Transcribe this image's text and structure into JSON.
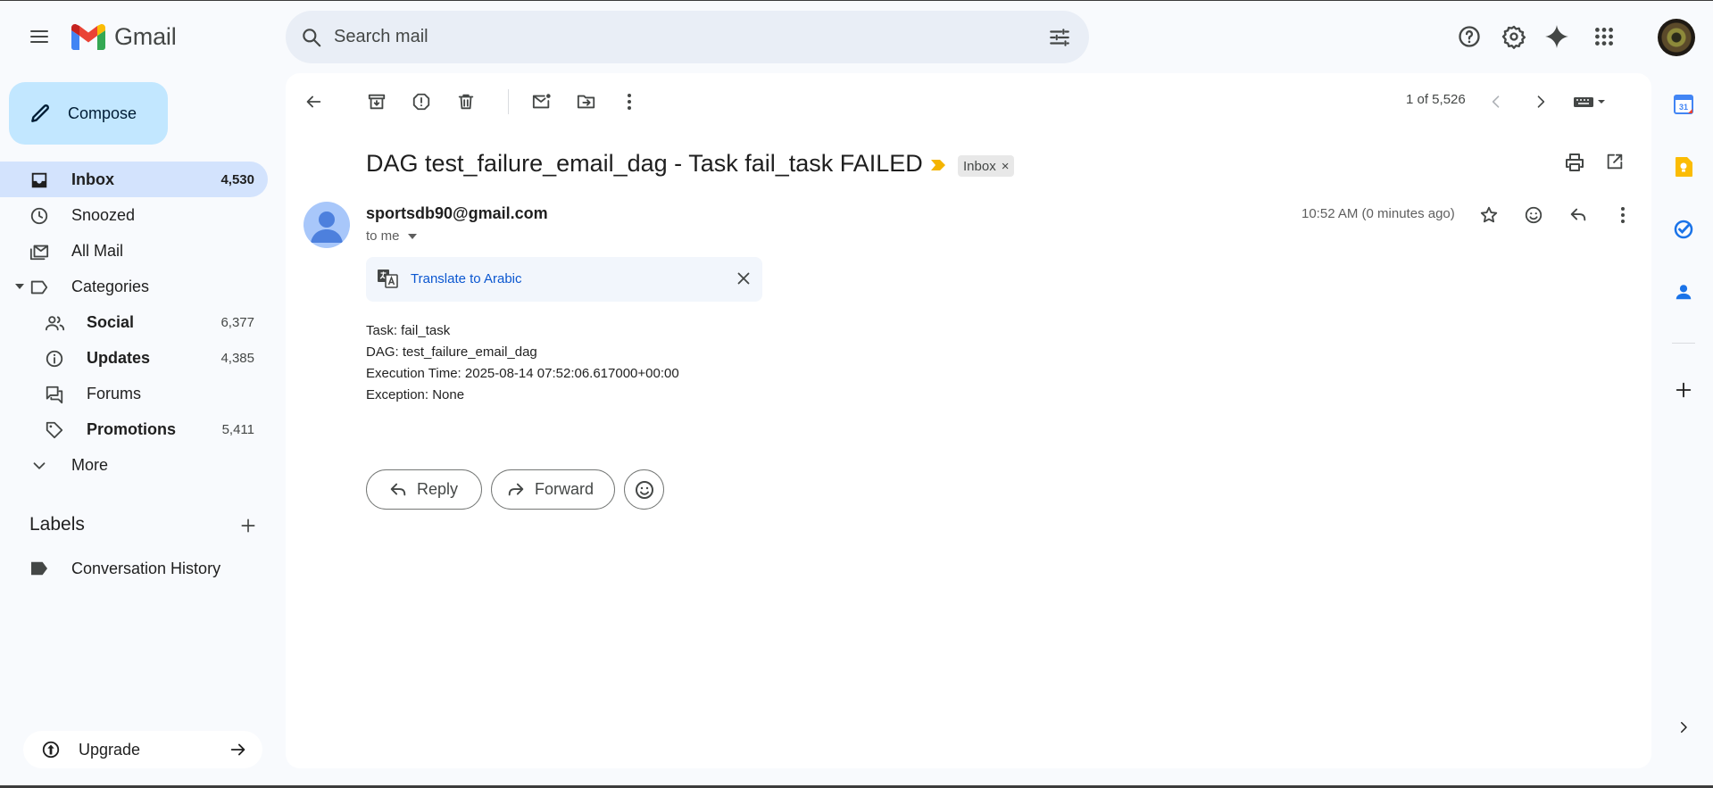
{
  "app": {
    "name": "Gmail"
  },
  "search": {
    "placeholder": "Search mail"
  },
  "compose": {
    "label": "Compose"
  },
  "nav": [
    {
      "label": "Inbox",
      "count": "4,530",
      "icon": "inbox-icon"
    },
    {
      "label": "Snoozed",
      "count": "",
      "icon": "clock-icon"
    },
    {
      "label": "All Mail",
      "count": "",
      "icon": "all-mail-icon"
    },
    {
      "label": "Categories",
      "count": "",
      "icon": "label-outline-icon"
    },
    {
      "label": "Social",
      "count": "6,377",
      "icon": "people-icon"
    },
    {
      "label": "Updates",
      "count": "4,385",
      "icon": "info-icon"
    },
    {
      "label": "Forums",
      "count": "",
      "icon": "forum-icon"
    },
    {
      "label": "Promotions",
      "count": "5,411",
      "icon": "tag-icon"
    },
    {
      "label": "More",
      "count": "",
      "icon": "chevron-down-icon"
    }
  ],
  "labels": {
    "heading": "Labels",
    "items": [
      {
        "label": "Conversation History",
        "icon": "label-filled-icon"
      }
    ]
  },
  "upgrade": {
    "label": "Upgrade"
  },
  "toolbar": {
    "pager": "1 of 5,526"
  },
  "email": {
    "subject": "DAG test_failure_email_dag - Task fail_task FAILED",
    "inbox_chip": "Inbox",
    "inbox_chip_close": "×",
    "sender": "sportsdb90@gmail.com",
    "to": "to me",
    "time": "10:52 AM (0 minutes ago)",
    "translate": "Translate to Arabic",
    "body": [
      "Task: fail_task",
      "DAG: test_failure_email_dag",
      "Execution Time: 2025-08-14 07:52:06.617000+00:00",
      "Exception: None"
    ]
  },
  "actions": {
    "reply": "Reply",
    "forward": "Forward"
  },
  "rail": {
    "calendar_day": "31"
  },
  "colors": {
    "accent": "#0b57d0",
    "compose_bg": "#c2e7ff",
    "active_nav": "#d3e3fd",
    "important": "#f4b400"
  }
}
